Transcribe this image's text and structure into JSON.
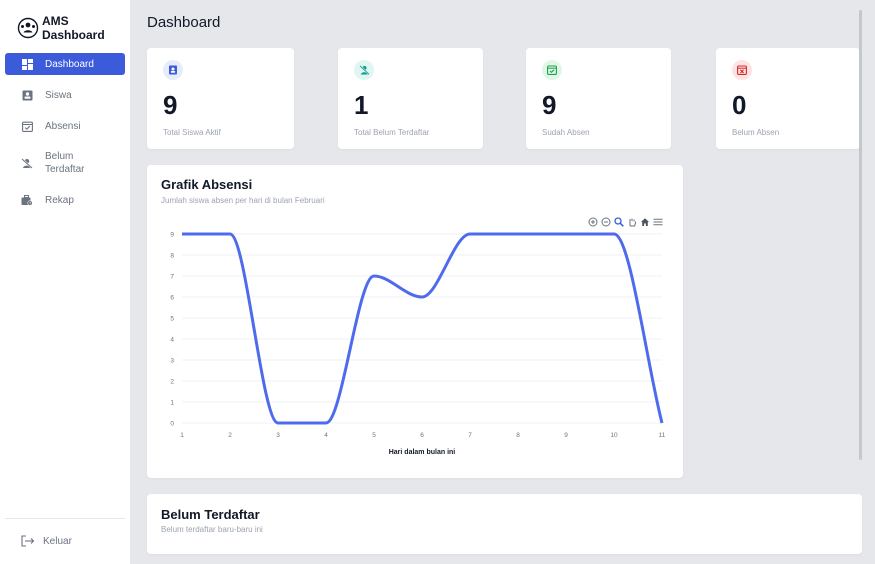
{
  "brand": {
    "title": "AMS Dashboard"
  },
  "sidebar": {
    "items": [
      {
        "label": "Dashboard",
        "icon": "dashboard-icon",
        "active": true
      },
      {
        "label": "Siswa",
        "icon": "student-icon",
        "active": false
      },
      {
        "label": "Absensi",
        "icon": "calendar-check-icon",
        "active": false
      },
      {
        "label": "Belum Terdaftar",
        "line1": "Belum",
        "line2": "Terdaftar",
        "icon": "user-slash-icon",
        "active": false
      },
      {
        "label": "Rekap",
        "icon": "briefcase-clock-icon",
        "active": false
      }
    ],
    "logout_label": "Keluar"
  },
  "page": {
    "title": "Dashboard"
  },
  "stats": [
    {
      "value": "9",
      "label": "Total Siswa Aktif",
      "icon": "id-badge-icon",
      "color": "#3b5bdb",
      "bg": "#e7ecfb"
    },
    {
      "value": "1",
      "label": "Total Belum Terdaftar",
      "icon": "user-slash-icon",
      "color": "#0f9d8a",
      "bg": "#dff6f2"
    },
    {
      "value": "9",
      "label": "Sudah Absen",
      "icon": "calendar-check-icon",
      "color": "#16a34a",
      "bg": "#e2f6e8"
    },
    {
      "value": "0",
      "label": "Belum Absen",
      "icon": "calendar-x-icon",
      "color": "#dc2626",
      "bg": "#fde4e4"
    }
  ],
  "chart": {
    "title": "Grafik Absensi",
    "subtitle": "Jumlah siswa absen per hari di bulan Februari",
    "toolbar": [
      "zoom-in-icon",
      "zoom-out-icon",
      "magnifier-icon",
      "pan-hand-icon",
      "home-icon",
      "menu-icon"
    ]
  },
  "chart_data": {
    "type": "line",
    "x": [
      1,
      2,
      3,
      4,
      5,
      6,
      7,
      8,
      9,
      10,
      11
    ],
    "series": [
      {
        "values": [
          9,
          9,
          0,
          0,
          7,
          6,
          9,
          9,
          9,
          9,
          0
        ]
      }
    ],
    "xlabel": "Hari dalam bulan ini",
    "ylabel": "",
    "ylim": [
      0,
      9
    ],
    "yticks": [
      0,
      1,
      2,
      3,
      4,
      5,
      6,
      7,
      8,
      9
    ],
    "grid": true,
    "line_color": "#4f6bed"
  },
  "belum": {
    "title": "Belum Terdaftar",
    "subtitle": "Belum terdaftar baru-baru ini"
  }
}
